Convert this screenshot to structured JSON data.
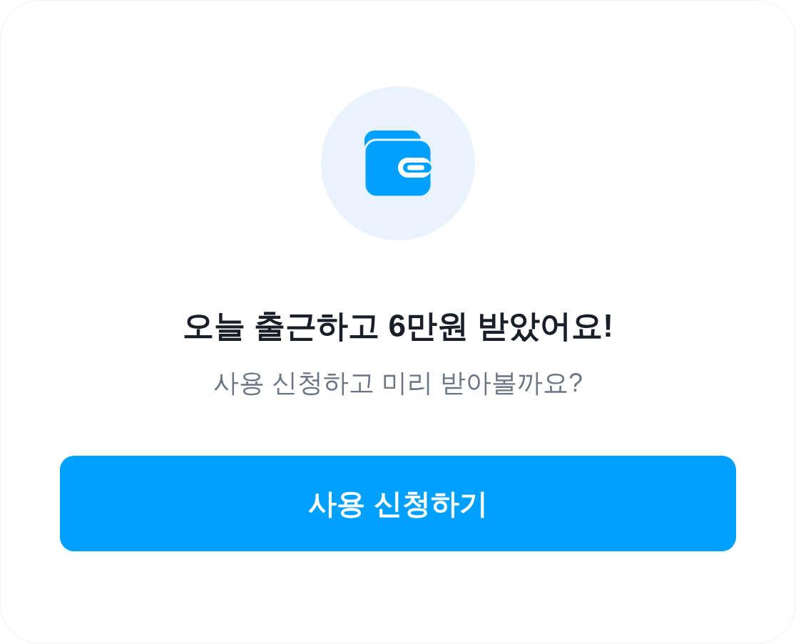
{
  "title": "오늘 출근하고 6만원 받았어요!",
  "subtitle": "사용 신청하고 미리 받아볼까요?",
  "button": "사용 신청하기"
}
